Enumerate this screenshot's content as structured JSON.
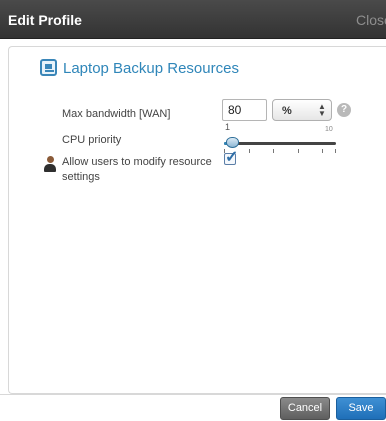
{
  "dialog": {
    "title": "Edit Profile",
    "close_label": "Close"
  },
  "section": {
    "title": "Laptop Backup Resources",
    "icon": "backup-resources-icon"
  },
  "form": {
    "bandwidth": {
      "label": "Max bandwidth [WAN]",
      "value": "80",
      "unit": "%"
    },
    "cpu_priority": {
      "label": "CPU priority",
      "min_label": "1",
      "max_label": "10",
      "value": 1,
      "min": 1,
      "max": 10
    },
    "allow_modify": {
      "label": "Allow users to modify resource settings",
      "checked": true
    }
  },
  "buttons": {
    "cancel": "Cancel",
    "save": "Save"
  },
  "colors": {
    "titlebar": "#333333",
    "accent": "#2f86b9",
    "save_button": "#2b7fc7",
    "cancel_button": "#6f6f6f"
  }
}
